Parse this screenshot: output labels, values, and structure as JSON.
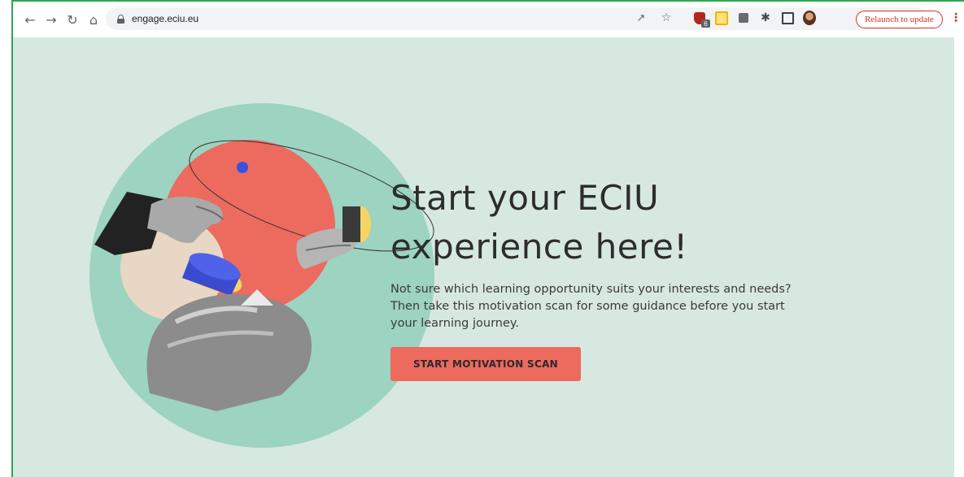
{
  "browser": {
    "url": "engage.eciu.eu",
    "relaunch_label": "Relaunch to update",
    "shield_badge": "6"
  },
  "hero": {
    "headline_line1": "Start your ECIU",
    "headline_line2": "experience here!",
    "description": "Not sure which learning opportunity suits your interests and needs? Then take this motivation scan for some guidance before you start your learning journey.",
    "cta_label": "START MOTIVATION SCAN"
  },
  "colors": {
    "page_background": "#d7e8e1",
    "circle_teal": "#9dd3c1",
    "circle_coral": "#ec6a5e",
    "cta_background": "#ec6a5e",
    "accent_blue": "#3b4fe0",
    "accent_yellow": "#f5d463"
  },
  "icons": [
    "back-icon",
    "forward-icon",
    "reload-icon",
    "home-icon",
    "lock-icon",
    "share-icon",
    "bookmark-star-icon",
    "shield-extension-icon",
    "yellow-extension-icon",
    "grey-extension-icon",
    "puzzle-extensions-icon",
    "side-panel-icon",
    "profile-avatar",
    "menu-dots-icon"
  ]
}
